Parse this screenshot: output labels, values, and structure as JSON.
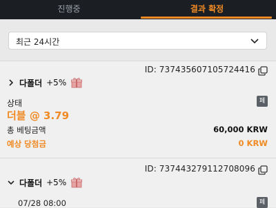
{
  "tabs": {
    "in_progress": "진행중",
    "confirmed": "결과 확정"
  },
  "filter": {
    "selected": "최근 24시간",
    "icon": "chevron-down-icon"
  },
  "bets": [
    {
      "id_label": "ID: 737435607105724416",
      "type": "다폴더",
      "bonus": "+5%",
      "status_label": "상태",
      "status_value": "더블 @ 3.79",
      "stake_label": "총 베팅금액",
      "stake_value": "60,000 KRW",
      "payout_label": "예상 당첨금",
      "payout_value": "0 KRW",
      "doc_icon_text": "페"
    },
    {
      "id_label": "ID: 737443279112708096",
      "type": "다폴더",
      "bonus": "+5%",
      "date": "07/28 08:00",
      "doc_icon_text": "페"
    }
  ],
  "colors": {
    "accent": "#f08a24",
    "tabbar": "#1b1f23"
  }
}
